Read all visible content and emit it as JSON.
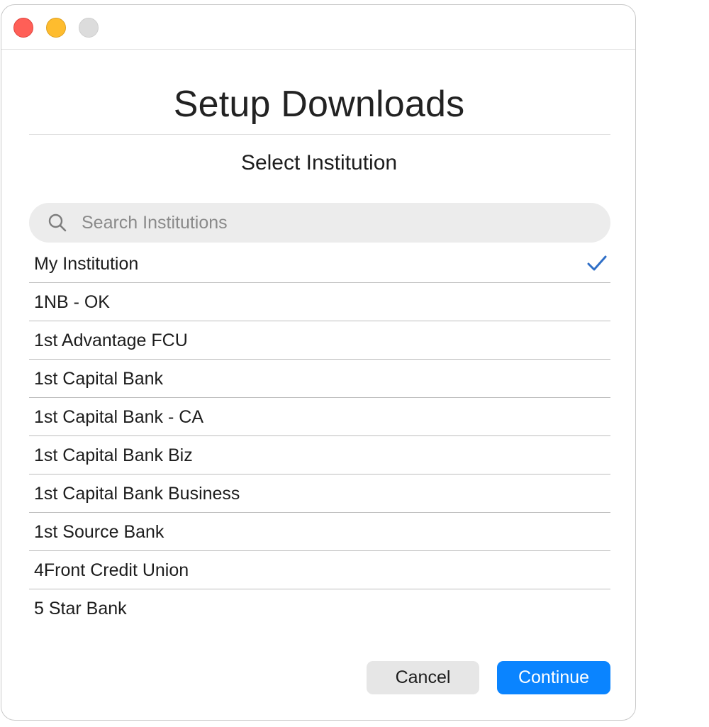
{
  "window": {
    "controls": [
      "close",
      "minimize",
      "zoom"
    ]
  },
  "header": {
    "title": "Setup Downloads",
    "subtitle": "Select Institution"
  },
  "search": {
    "placeholder": "Search Institutions",
    "value": "",
    "icon": "search-icon"
  },
  "institutions": {
    "selected_index": 0,
    "items": [
      {
        "label": "My Institution",
        "selected": true
      },
      {
        "label": "1NB - OK",
        "selected": false
      },
      {
        "label": "1st Advantage FCU",
        "selected": false
      },
      {
        "label": "1st Capital Bank",
        "selected": false
      },
      {
        "label": "1st Capital Bank - CA",
        "selected": false
      },
      {
        "label": "1st Capital Bank Biz",
        "selected": false
      },
      {
        "label": "1st Capital Bank Business",
        "selected": false
      },
      {
        "label": "1st Source Bank",
        "selected": false
      },
      {
        "label": "4Front Credit Union",
        "selected": false
      },
      {
        "label": "5 Star Bank",
        "selected": false
      }
    ]
  },
  "footer": {
    "cancel_label": "Cancel",
    "continue_label": "Continue"
  },
  "colors": {
    "accent": "#0a84ff",
    "checkmark": "#2f6fc7",
    "close": "#ff5f57",
    "minimize": "#febc2e",
    "zoom_disabled": "#dcdcdc"
  }
}
